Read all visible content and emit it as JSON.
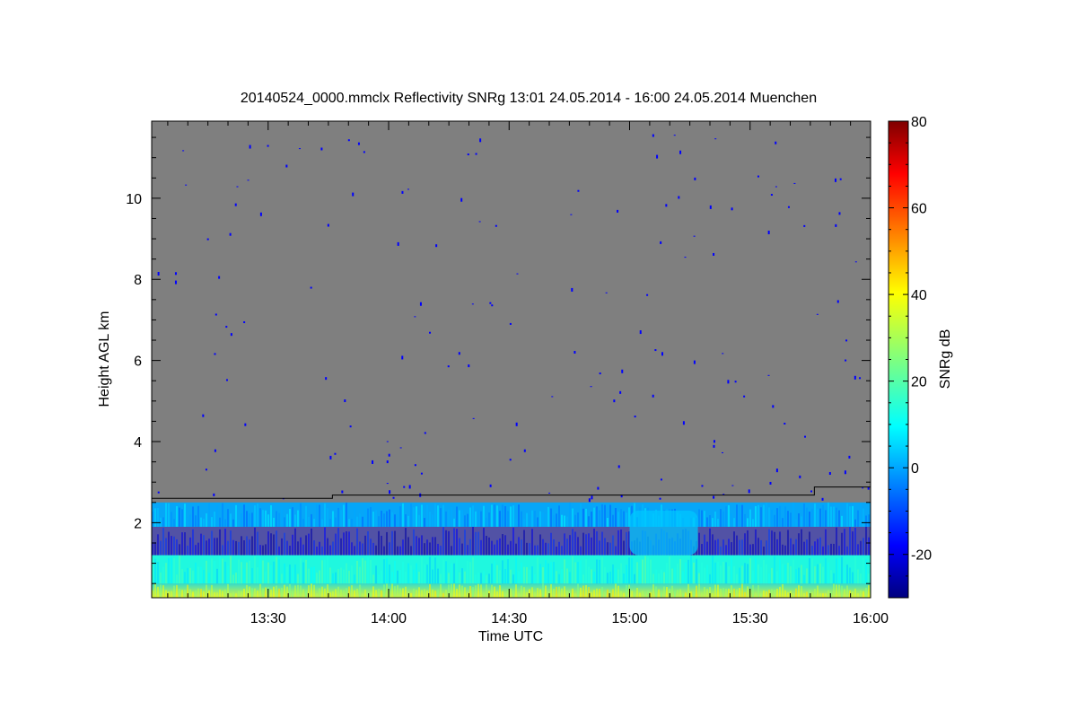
{
  "chart_data": {
    "type": "heatmap",
    "title": "20140524_0000.mmclx Reflectivity SNRg   13:01 24.05.2014 - 16:00 24.05.2014 Muenchen",
    "xlabel": "Time UTC",
    "ylabel": "Height AGL km",
    "xlim": [
      "13:01",
      "16:00"
    ],
    "ylim": [
      0.15,
      11.9
    ],
    "x_ticks": [
      "13:30",
      "14:00",
      "14:30",
      "15:00",
      "15:30",
      "16:00"
    ],
    "y_ticks": [
      2,
      4,
      6,
      8,
      10
    ],
    "background_color": "#7f7f7f",
    "colorbar": {
      "label": "SNRg dB",
      "range": [
        -30,
        80
      ],
      "ticks": [
        -20,
        0,
        20,
        40,
        60,
        80
      ],
      "colormap": "jet"
    },
    "boundary_line": {
      "color": "#000000",
      "points": [
        {
          "time": "13:01",
          "height": 2.6
        },
        {
          "time": "13:46",
          "height": 2.6
        },
        {
          "time": "13:46",
          "height": 2.68
        },
        {
          "time": "15:46",
          "height": 2.68
        },
        {
          "time": "15:46",
          "height": 2.88
        },
        {
          "time": "16:00",
          "height": 2.88
        }
      ]
    },
    "layers": [
      {
        "height_range": [
          0.15,
          0.5
        ],
        "snr_db": 33
      },
      {
        "height_range": [
          0.5,
          1.2
        ],
        "snr_db": 14
      },
      {
        "height_range": [
          1.2,
          1.9
        ],
        "snr_db": -18
      },
      {
        "height_range": [
          1.9,
          2.5
        ],
        "snr_db": 2
      }
    ],
    "features": [
      {
        "time_range": [
          "15:00",
          "15:17"
        ],
        "height_range": [
          1.2,
          2.3
        ],
        "snr_db": 5
      }
    ]
  }
}
